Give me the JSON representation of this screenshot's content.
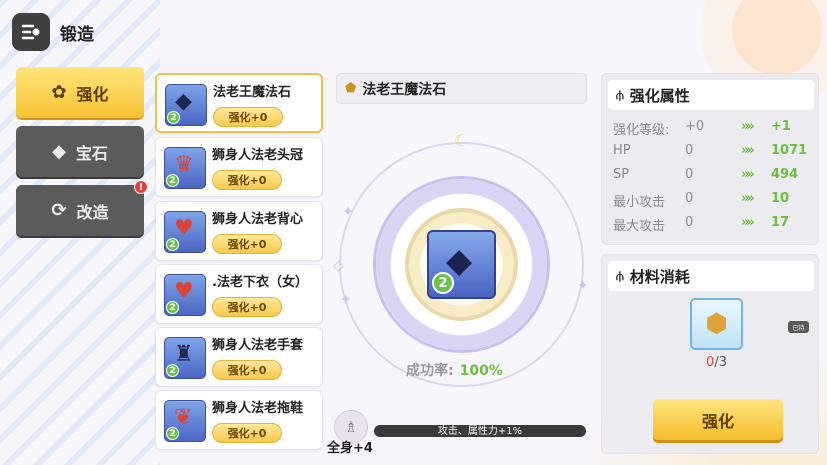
{
  "header": {
    "title": "锻造",
    "back_icon": "forge-menu-icon"
  },
  "tabs": [
    {
      "label": "强化",
      "icon": "flower-shield-icon",
      "active": true
    },
    {
      "label": "宝石",
      "icon": "diamond-icon",
      "active": false
    },
    {
      "label": "改造",
      "icon": "refresh-cog-icon",
      "active": false,
      "badge": "!"
    }
  ],
  "items": [
    {
      "name": "法老王魔法石",
      "tag": "强化+0",
      "level": "2",
      "selected": true
    },
    {
      "name": "狮身人法老头冠",
      "tag": "强化+0",
      "level": "2"
    },
    {
      "name": "狮身人法老背心",
      "tag": "强化+0",
      "level": "2"
    },
    {
      "name": ".法老下衣（女）",
      "tag": "强化+0",
      "level": "2"
    },
    {
      "name": "狮身人法老手套",
      "tag": "强化+0",
      "level": "2"
    },
    {
      "name": "狮身人法老拖鞋",
      "tag": "强化+0",
      "level": "2"
    }
  ],
  "selected": {
    "name": "法老王魔法石",
    "level": "2"
  },
  "success": {
    "label": "成功率:",
    "value": "100%"
  },
  "bonus": {
    "label": "全身+4",
    "text": "攻击、属性力+1%"
  },
  "stats_panel": {
    "title": "强化属性",
    "rows": [
      {
        "label": "强化等级:",
        "current": "+0",
        "next": "+1"
      },
      {
        "label": "HP",
        "current": "0",
        "next": "1071"
      },
      {
        "label": "SP",
        "current": "0",
        "next": "494"
      },
      {
        "label": "最小攻击",
        "current": "0",
        "next": "10"
      },
      {
        "label": "最大攻击",
        "current": "0",
        "next": "17"
      }
    ],
    "arrow": "»»"
  },
  "materials_panel": {
    "title": "材料消耗",
    "material": {
      "icon": "ore-icon",
      "have": "0",
      "need": "/3"
    },
    "mini_tag": "已持"
  },
  "action": {
    "label": "强化"
  },
  "colors": {
    "accent": "#f5c233",
    "positive": "#6cbf3d",
    "danger": "#e04545"
  }
}
